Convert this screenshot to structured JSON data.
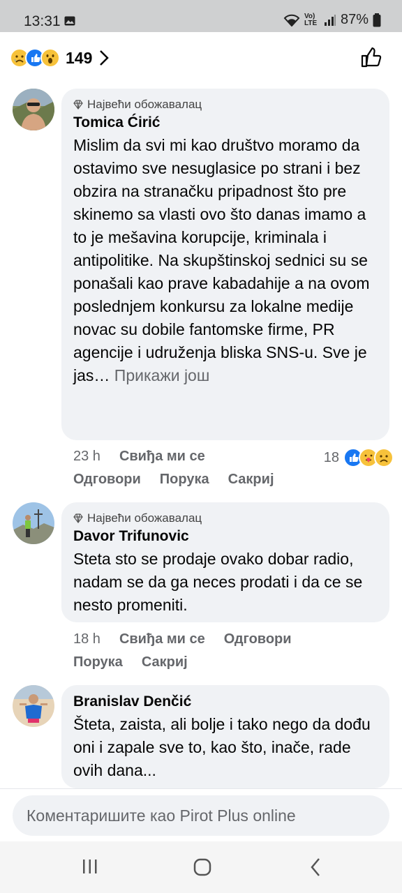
{
  "status_bar": {
    "time": "13:31",
    "battery": "87%",
    "network": "Vo) LTE"
  },
  "header": {
    "reaction_count": "149",
    "reaction_icons": [
      "sad-emoji-icon",
      "like-emoji-icon",
      "wow-emoji-icon"
    ]
  },
  "comments": [
    {
      "badge": "Највећи обожавалац",
      "author": "Tomica Ćirić",
      "text": "Mislim da svi mi kao društvo moramo da ostavimo sve nesuglasice po strani i bez obzira na stranačku pripadnost što pre skinemo sa vlasti ovo što danas imamo a to je mešavina korupcije, kriminala i antipolitike. Na skupštinskoj sednici su se ponašali kao prave kabadahije a na ovom poslednjem konkursu za lokalne medije novac su dobile fantomske firme, PR agencije i udruženja bliska SNS-u. Sve je jas…",
      "see_more": "Прикажи још",
      "time": "23 h",
      "like": "Свиђа ми се",
      "reply": "Одговори",
      "message": "Порука",
      "hide": "Сакриј",
      "reactions_count": "18"
    },
    {
      "badge": "Највећи обожавалац",
      "author": "Davor Trifunovic",
      "text": "Steta sto se prodaje ovako dobar radio, nadam se da ga neces prodati i da ce se nesto promeniti.",
      "time": "18 h",
      "like": "Свиђа ми се",
      "reply": "Одговори",
      "message": "Порука",
      "hide": "Сакриј"
    },
    {
      "author": "Branislav Denčić",
      "text": "Šteta, zaista, ali bolje i tako nego da dođu oni i zapale sve to, kao što, inače, rade ovih dana..."
    }
  ],
  "composer": {
    "placeholder": "Коментаришите као Pirot Plus online"
  },
  "colors": {
    "bubble": "#f0f2f5",
    "secondary_text": "#65676b",
    "like_blue": "#1877f2"
  }
}
